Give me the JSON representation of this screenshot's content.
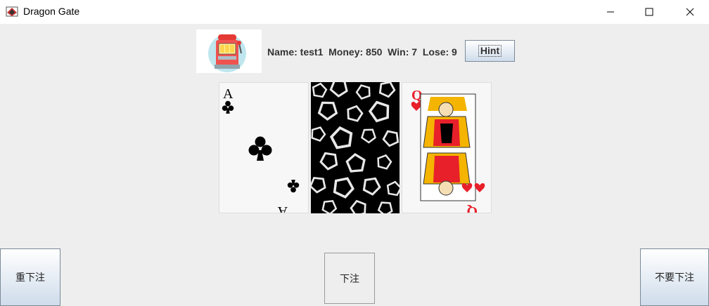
{
  "window": {
    "title": "Dragon Gate",
    "app_icon": "card-game-icon",
    "controls": [
      "minimize-icon",
      "maximize-icon",
      "close-icon"
    ]
  },
  "player": {
    "info_text": "Name: test1  Money: 850  Win: 7  Lose: 9",
    "hint_label": "Hint",
    "machine_image": "slot-machine-icon"
  },
  "cards": [
    {
      "rank": "A",
      "suit": "clubs",
      "color": "#000000",
      "face": "up"
    },
    {
      "face": "down",
      "back_pattern": "white-pentagons-on-black"
    },
    {
      "rank": "Q",
      "suit": "hearts",
      "color": "#e8202a",
      "face": "up"
    }
  ],
  "buttons": {
    "rebet": "重下注",
    "bet": "下注",
    "no_bet": "不要下注"
  },
  "colors": {
    "window_bg": "#eeeeee",
    "button_gradient_bottom": "#cfdceb",
    "heart_red": "#e8202a"
  }
}
